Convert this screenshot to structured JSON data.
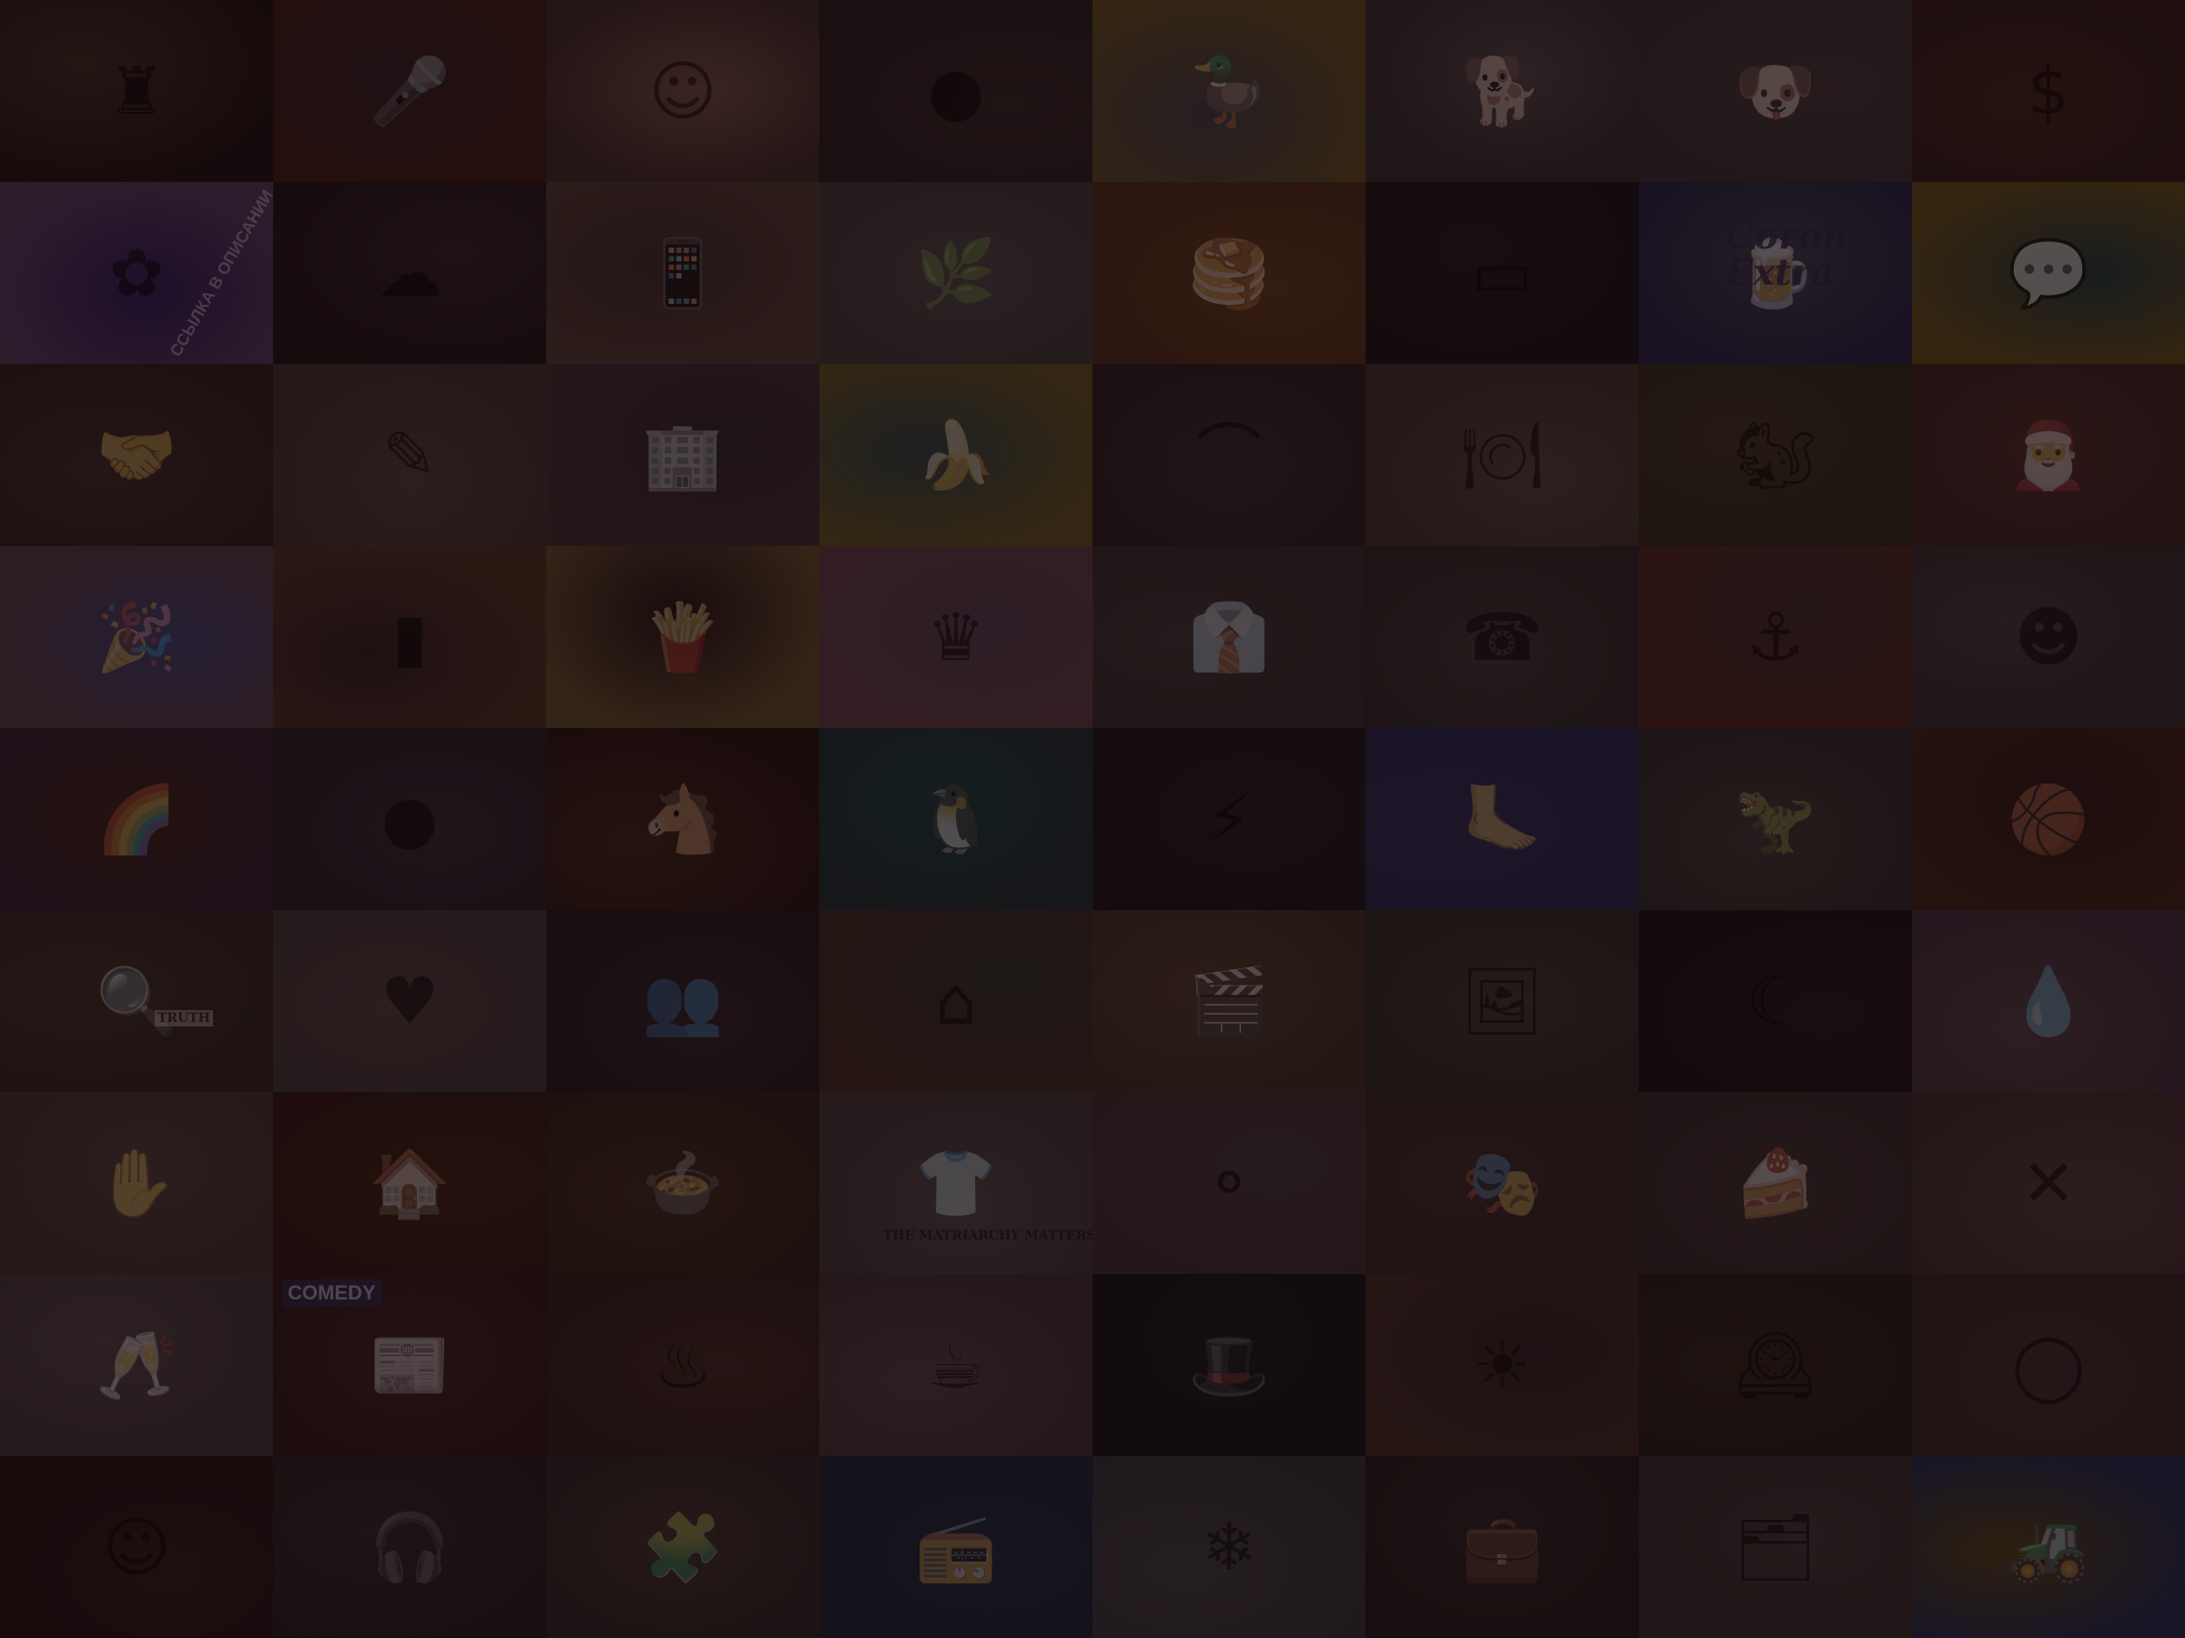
{
  "background": {
    "overlay_color": "#14060a",
    "tiles": [
      {
        "name": "chess-board-photo",
        "icon": "chess-icon",
        "colors": [
          "#3a2a22",
          "#1a1210"
        ]
      },
      {
        "name": "singer-on-stage-photo",
        "icon": "microphone-icon",
        "colors": [
          "#2a1f22",
          "#3c1a14"
        ]
      },
      {
        "name": "woman-headache-photo",
        "icon": "face-icon",
        "colors": [
          "#6a4a40",
          "#3a2a26"
        ]
      },
      {
        "name": "wall-hole-photo",
        "icon": "hole-icon",
        "colors": [
          "#2e2624",
          "#221c1c"
        ]
      },
      {
        "name": "rubber-duck-harbor-photo",
        "icon": "duck-icon",
        "colors": [
          "#3a3c40",
          "#5a4a20"
        ]
      },
      {
        "name": "akita-dog-photo",
        "icon": "dog-icon",
        "colors": [
          "#4a4444",
          "#2e2a2a"
        ]
      },
      {
        "name": "dead-dog-logo",
        "icon": "dog-face-icon",
        "colors": [
          "#3c3434",
          "#342e2e"
        ]
      },
      {
        "name": "money-stock-ticker-photo",
        "icon": "money-icon",
        "colors": [
          "#3a2418",
          "#2a1a18"
        ]
      },
      {
        "name": "purple-collage-poster",
        "icon": "collage-icon",
        "colors": [
          "#2a1a55",
          "#4a3a5a"
        ],
        "caption": "ССЫЛКА В ОПИСАНИИ"
      },
      {
        "name": "hookah-smoke-photo",
        "icon": "smoke-icon",
        "colors": [
          "#2a2022",
          "#1a1416"
        ]
      },
      {
        "name": "mirror-selfie-photo",
        "icon": "phone-icon",
        "colors": [
          "#3a2a2a",
          "#4a3a30"
        ]
      },
      {
        "name": "figurines-plant-photo",
        "icon": "plant-icon",
        "colors": [
          "#4a4242",
          "#3a3838"
        ]
      },
      {
        "name": "potato-pancakes-photo",
        "icon": "food-icon",
        "colors": [
          "#5a3a1a",
          "#4a2a1a"
        ]
      },
      {
        "name": "dark-table-photo",
        "icon": "table-icon",
        "colors": [
          "#1e1a1c",
          "#161214"
        ]
      },
      {
        "name": "corona-extra-box",
        "icon": "beer-icon",
        "colors": [
          "#3a3c48",
          "#1e2240"
        ],
        "caption": "Corona Extra"
      },
      {
        "name": "speech-bubble-teal",
        "icon": "speech-bubble-icon",
        "colors": [
          "#1e3a3a",
          "#5a4a18"
        ]
      },
      {
        "name": "holding-hands-photo",
        "icon": "hands-icon",
        "colors": [
          "#3a2a26",
          "#2a1e1c"
        ]
      },
      {
        "name": "tattoo-arm-photo",
        "icon": "tattoo-icon",
        "colors": [
          "#4a3c3a",
          "#3a302e"
        ]
      },
      {
        "name": "colorful-building-photo",
        "icon": "building-icon",
        "colors": [
          "#2a2428",
          "#3a2a30"
        ]
      },
      {
        "name": "banana-photo",
        "icon": "banana-icon",
        "colors": [
          "#2a4040",
          "#5a5020"
        ]
      },
      {
        "name": "bridge-ruins-photo",
        "icon": "bridge-icon",
        "colors": [
          "#2e2828",
          "#242020"
        ]
      },
      {
        "name": "salad-plate-photo",
        "icon": "plate-icon",
        "colors": [
          "#4a4038",
          "#3a3028"
        ]
      },
      {
        "name": "gophers-photo",
        "icon": "animal-icon",
        "colors": [
          "#3a3420",
          "#2a2818"
        ]
      },
      {
        "name": "santa-chair-photo",
        "icon": "santa-icon",
        "colors": [
          "#4a2a26",
          "#3a2220"
        ]
      },
      {
        "name": "women-karaoke-photo",
        "icon": "party-icon",
        "colors": [
          "#3a3c6a",
          "#4a3a40"
        ]
      },
      {
        "name": "leather-phone-case-photo",
        "icon": "wallet-icon",
        "colors": [
          "#2a1e1e",
          "#4a3020"
        ]
      },
      {
        "name": "fried-chips-photo",
        "icon": "chips-icon",
        "colors": [
          "#1e1412",
          "#5a4a2a"
        ]
      },
      {
        "name": "disney-princesses-photo",
        "icon": "crown-icon",
        "colors": [
          "#4a3a4a",
          "#5a3a40"
        ]
      },
      {
        "name": "office-men-photo",
        "icon": "suit-icon",
        "colors": [
          "#3a3634",
          "#2e2a28"
        ]
      },
      {
        "name": "woman-on-phone-photo",
        "icon": "phone-call-icon",
        "colors": [
          "#3a3634",
          "#2a2624"
        ]
      },
      {
        "name": "ship-captain-photo",
        "icon": "captain-icon",
        "colors": [
          "#3a2a26",
          "#4a2420"
        ]
      },
      {
        "name": "ventriloquist-doll-photo",
        "icon": "puppet-icon",
        "colors": [
          "#3e3a3a",
          "#2e2a2a"
        ]
      },
      {
        "name": "rainbow-toys-photo",
        "icon": "rainbow-icon",
        "colors": [
          "#3a2018",
          "#2a1e2a"
        ]
      },
      {
        "name": "orbit-sphere-photo",
        "icon": "planet-icon",
        "colors": [
          "#2a2a30",
          "#1e1e24"
        ]
      },
      {
        "name": "horse-closeup-photo",
        "icon": "horse-icon",
        "colors": [
          "#3a2416",
          "#241410"
        ]
      },
      {
        "name": "penguin-underwater-photo",
        "icon": "penguin-icon",
        "colors": [
          "#143a3a",
          "#1a2e30"
        ]
      },
      {
        "name": "power-rangers-photo",
        "icon": "ranger-icon",
        "colors": [
          "#201a1e",
          "#1a1418"
        ]
      },
      {
        "name": "legs-blue-wall-photo",
        "icon": "leg-icon",
        "colors": [
          "#2a2a50",
          "#22244a"
        ]
      },
      {
        "name": "dinosaur-cliff-photo",
        "icon": "dinosaur-icon",
        "colors": [
          "#3a3a34",
          "#2a2a26"
        ]
      },
      {
        "name": "basketball-hands-photo",
        "icon": "basketball-icon",
        "colors": [
          "#2a1812",
          "#3a2014"
        ]
      },
      {
        "name": "detective-desk-photo",
        "icon": "magnifier-icon",
        "colors": [
          "#3a2e26",
          "#2a221e"
        ],
        "caption": "TRUTH"
      },
      {
        "name": "happy-couple-photo",
        "icon": "couple-icon",
        "colors": [
          "#4a3c3a",
          "#3a3434"
        ]
      },
      {
        "name": "group-night-photo",
        "icon": "group-icon",
        "colors": [
          "#2a2222",
          "#1e1818"
        ]
      },
      {
        "name": "green-room-interior-photo",
        "icon": "room-icon",
        "colors": [
          "#2a3028",
          "#3a2a20"
        ]
      },
      {
        "name": "movie-scene-photo",
        "icon": "film-icon",
        "colors": [
          "#4a3a2a",
          "#3a2e22"
        ]
      },
      {
        "name": "baroque-painting-photo",
        "icon": "painting-icon",
        "colors": [
          "#3a3630",
          "#2a2824"
        ]
      },
      {
        "name": "night-landscape-photo",
        "icon": "moon-icon",
        "colors": [
          "#1e1a1c",
          "#161214"
        ]
      },
      {
        "name": "slime-hands-photo",
        "icon": "slime-icon",
        "colors": [
          "#4a3c3c",
          "#3a2e3a"
        ]
      },
      {
        "name": "facial-treatment-photo",
        "icon": "spa-icon",
        "colors": [
          "#4a3c38",
          "#3a302c"
        ]
      },
      {
        "name": "gingerbread-city-photo",
        "icon": "gingerbread-icon",
        "colors": [
          "#3a2014",
          "#2a1810"
        ]
      },
      {
        "name": "soup-bowl-photo",
        "icon": "bowl-icon",
        "colors": [
          "#3a2a1a",
          "#2a1e14"
        ]
      },
      {
        "name": "matriarchy-shirt-photo",
        "icon": "shirt-icon",
        "colors": [
          "#4a4444",
          "#3a3636"
        ],
        "caption": "THE MATRIARCHY MATTERS"
      },
      {
        "name": "pendulum-balls-photo",
        "icon": "pendulum-icon",
        "colors": [
          "#3a3434",
          "#3a2e2e"
        ]
      },
      {
        "name": "mime-friends-photo",
        "icon": "mime-icon",
        "colors": [
          "#3a2a28",
          "#2e2422"
        ]
      },
      {
        "name": "cake-slice-photo",
        "icon": "cake-icon",
        "colors": [
          "#3a3230",
          "#2e2826"
        ]
      },
      {
        "name": "x-signs-photo",
        "icon": "x-sign-icon",
        "colors": [
          "#4a3a38",
          "#3a2e2c"
        ]
      },
      {
        "name": "drink-hand-photo",
        "icon": "glass-icon",
        "colors": [
          "#4a4040",
          "#3a3434"
        ]
      },
      {
        "name": "comedy-magazine-covers",
        "icon": "magazine-icon",
        "colors": [
          "#3a2020",
          "#2a1818"
        ],
        "caption": "COMEDY"
      },
      {
        "name": "massage-photo",
        "icon": "massage-icon",
        "colors": [
          "#3a2820",
          "#2a1e18"
        ]
      },
      {
        "name": "pink-items-bed-photo",
        "icon": "cup-icon",
        "colors": [
          "#4a3c3e",
          "#3a3032"
        ]
      },
      {
        "name": "magic-hat-photo",
        "icon": "magic-hat-icon",
        "colors": [
          "#141a1a",
          "#101414"
        ]
      },
      {
        "name": "sunset-couple-photo",
        "icon": "sunset-icon",
        "colors": [
          "#2a2020",
          "#3a2a22"
        ]
      },
      {
        "name": "astronomical-clock-photo",
        "icon": "clock-icon",
        "colors": [
          "#2a2418",
          "#201c14"
        ]
      },
      {
        "name": "choker-neck-photo",
        "icon": "necklace-icon",
        "colors": [
          "#3a2e2c",
          "#2e2422"
        ]
      },
      {
        "name": "man-smiling-photo",
        "icon": "man-icon",
        "colors": [
          "#2a1a18",
          "#1e1412"
        ]
      },
      {
        "name": "cartoon-djs-illustration",
        "icon": "headphones-icon",
        "colors": [
          "#2a2626",
          "#1e1c1c"
        ]
      },
      {
        "name": "puzzle-table-photo",
        "icon": "puzzle-icon",
        "colors": [
          "#3a302c",
          "#2a2422"
        ]
      },
      {
        "name": "man-boombox-photo",
        "icon": "boombox-icon",
        "colors": [
          "#1a2a3a",
          "#142230"
        ]
      },
      {
        "name": "snow-queen-photo",
        "icon": "snowflake-icon",
        "colors": [
          "#3a3c40",
          "#2e3034"
        ]
      },
      {
        "name": "business-meeting-photo",
        "icon": "briefcase-icon",
        "colors": [
          "#2a2422",
          "#1e1a18"
        ]
      },
      {
        "name": "office-scene-photo",
        "icon": "office-icon",
        "colors": [
          "#3a3634",
          "#2e2a28"
        ]
      },
      {
        "name": "blue-tractor-cartoon",
        "icon": "tractor-icon",
        "colors": [
          "#4a4018",
          "#1e2a4a"
        ]
      }
    ]
  }
}
